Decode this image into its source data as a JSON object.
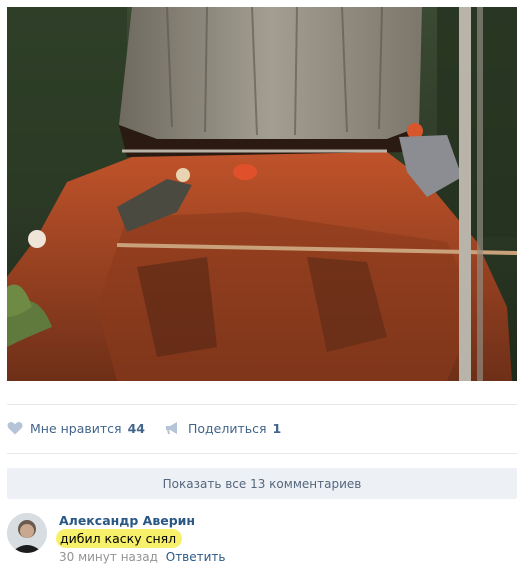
{
  "post": {
    "photo_icon": "logging-photo"
  },
  "actions": {
    "like_label": "Мне нравится",
    "like_count": "44",
    "share_label": "Поделиться",
    "share_count": "1"
  },
  "comments": {
    "show_all_label": "Показать все 13 комментариев",
    "items": [
      {
        "author": "Александр Аверин",
        "text": "дибил каску снял",
        "time": "30 минут назад",
        "reply_label": "Ответить"
      }
    ]
  },
  "colors": {
    "link": "#2a5885",
    "action": "#42648b",
    "muted": "#939393",
    "highlight": "#f7f06a",
    "button_bg": "#edf0f5"
  }
}
